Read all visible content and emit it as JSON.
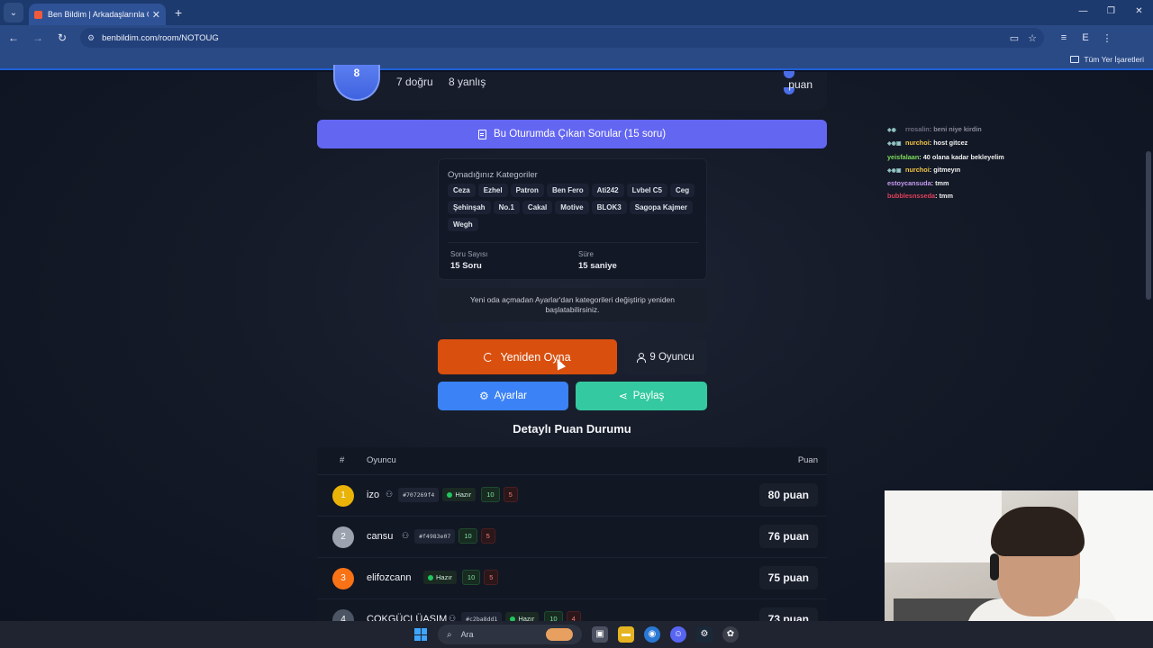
{
  "browser": {
    "tab_title": "Ben Bildim | Arkadaşlarınla Onli",
    "url": "benbildim.com/room/NOTOUG",
    "bookmarks_label": "Tüm Yer İşaretleri",
    "profile_letter": "E"
  },
  "summary": {
    "correct": "7 doğru",
    "wrong": "8 yanlış",
    "points_label": "puan",
    "avatar_letter": "8"
  },
  "questions_button": "Bu Oturumda Çıkan Sorular (15 soru)",
  "categories": {
    "title": "Oynadığınız Kategoriler",
    "items": [
      "Ceza",
      "Ezhel",
      "Patron",
      "Ben Fero",
      "Ati242",
      "Lvbel C5",
      "Ceg",
      "Şehinşah",
      "No.1",
      "Cakal",
      "Motive",
      "BLOK3",
      "Sagopa Kajmer",
      "Wegh"
    ],
    "question_count_label": "Soru Sayısı",
    "question_count_value": "15 Soru",
    "duration_label": "Süre",
    "duration_value": "15 saniye"
  },
  "info_text": "Yeni oda açmadan Ayarlar'dan kategorileri değiştirip yeniden başlatabilirsiniz.",
  "actions": {
    "replay": "Yeniden Oyna",
    "players": "9 Oyuncu",
    "settings": "Ayarlar",
    "share": "Paylaş"
  },
  "scoreboard": {
    "title": "Detaylı Puan Durumu",
    "headers": {
      "rank": "#",
      "player": "Oyuncu",
      "points": "Puan"
    },
    "rows": [
      {
        "rank": "1",
        "name": "izo",
        "hash": "#707269f4",
        "ready": "Hazır",
        "correct": "10",
        "wrong": "5",
        "score": "80 puan",
        "color": "#eab308"
      },
      {
        "rank": "2",
        "name": "cansu",
        "hash": "#f4983e07",
        "ready": "",
        "correct": "10",
        "wrong": "5",
        "score": "76 puan",
        "color": "#9ca3af"
      },
      {
        "rank": "3",
        "name": "elifozcann",
        "hash": "",
        "ready": "Hazır",
        "correct": "10",
        "wrong": "5",
        "score": "75 puan",
        "color": "#f97316"
      },
      {
        "rank": "4",
        "name": "COKGÜCLÜASIM",
        "hash": "#c2ba8dd1",
        "ready": "Hazır",
        "correct": "10",
        "wrong": "4",
        "score": "73 puan",
        "color": "#4b5563"
      }
    ]
  },
  "chat": [
    {
      "user": "rrosalin",
      "message": ": beni niye kirdin",
      "user_color": "#6d6d80"
    },
    {
      "user": "nurchoi",
      "message": ": host gitcez",
      "user_color": "#f5c542"
    },
    {
      "user": "yeisfalaan",
      "message": ": 40 olana kadar bekleyelim",
      "user_color": "#7cdc5a"
    },
    {
      "user": "nurchoi",
      "message": ": gitmeyın",
      "user_color": "#f5c542"
    },
    {
      "user": "estoycansuda",
      "message": ": tmm",
      "user_color": "#c79bf2"
    },
    {
      "user": "bubblesnsseda",
      "message": ": tmm",
      "user_color": "#e0405a"
    }
  ],
  "taskbar": {
    "search_placeholder": "Ara"
  }
}
